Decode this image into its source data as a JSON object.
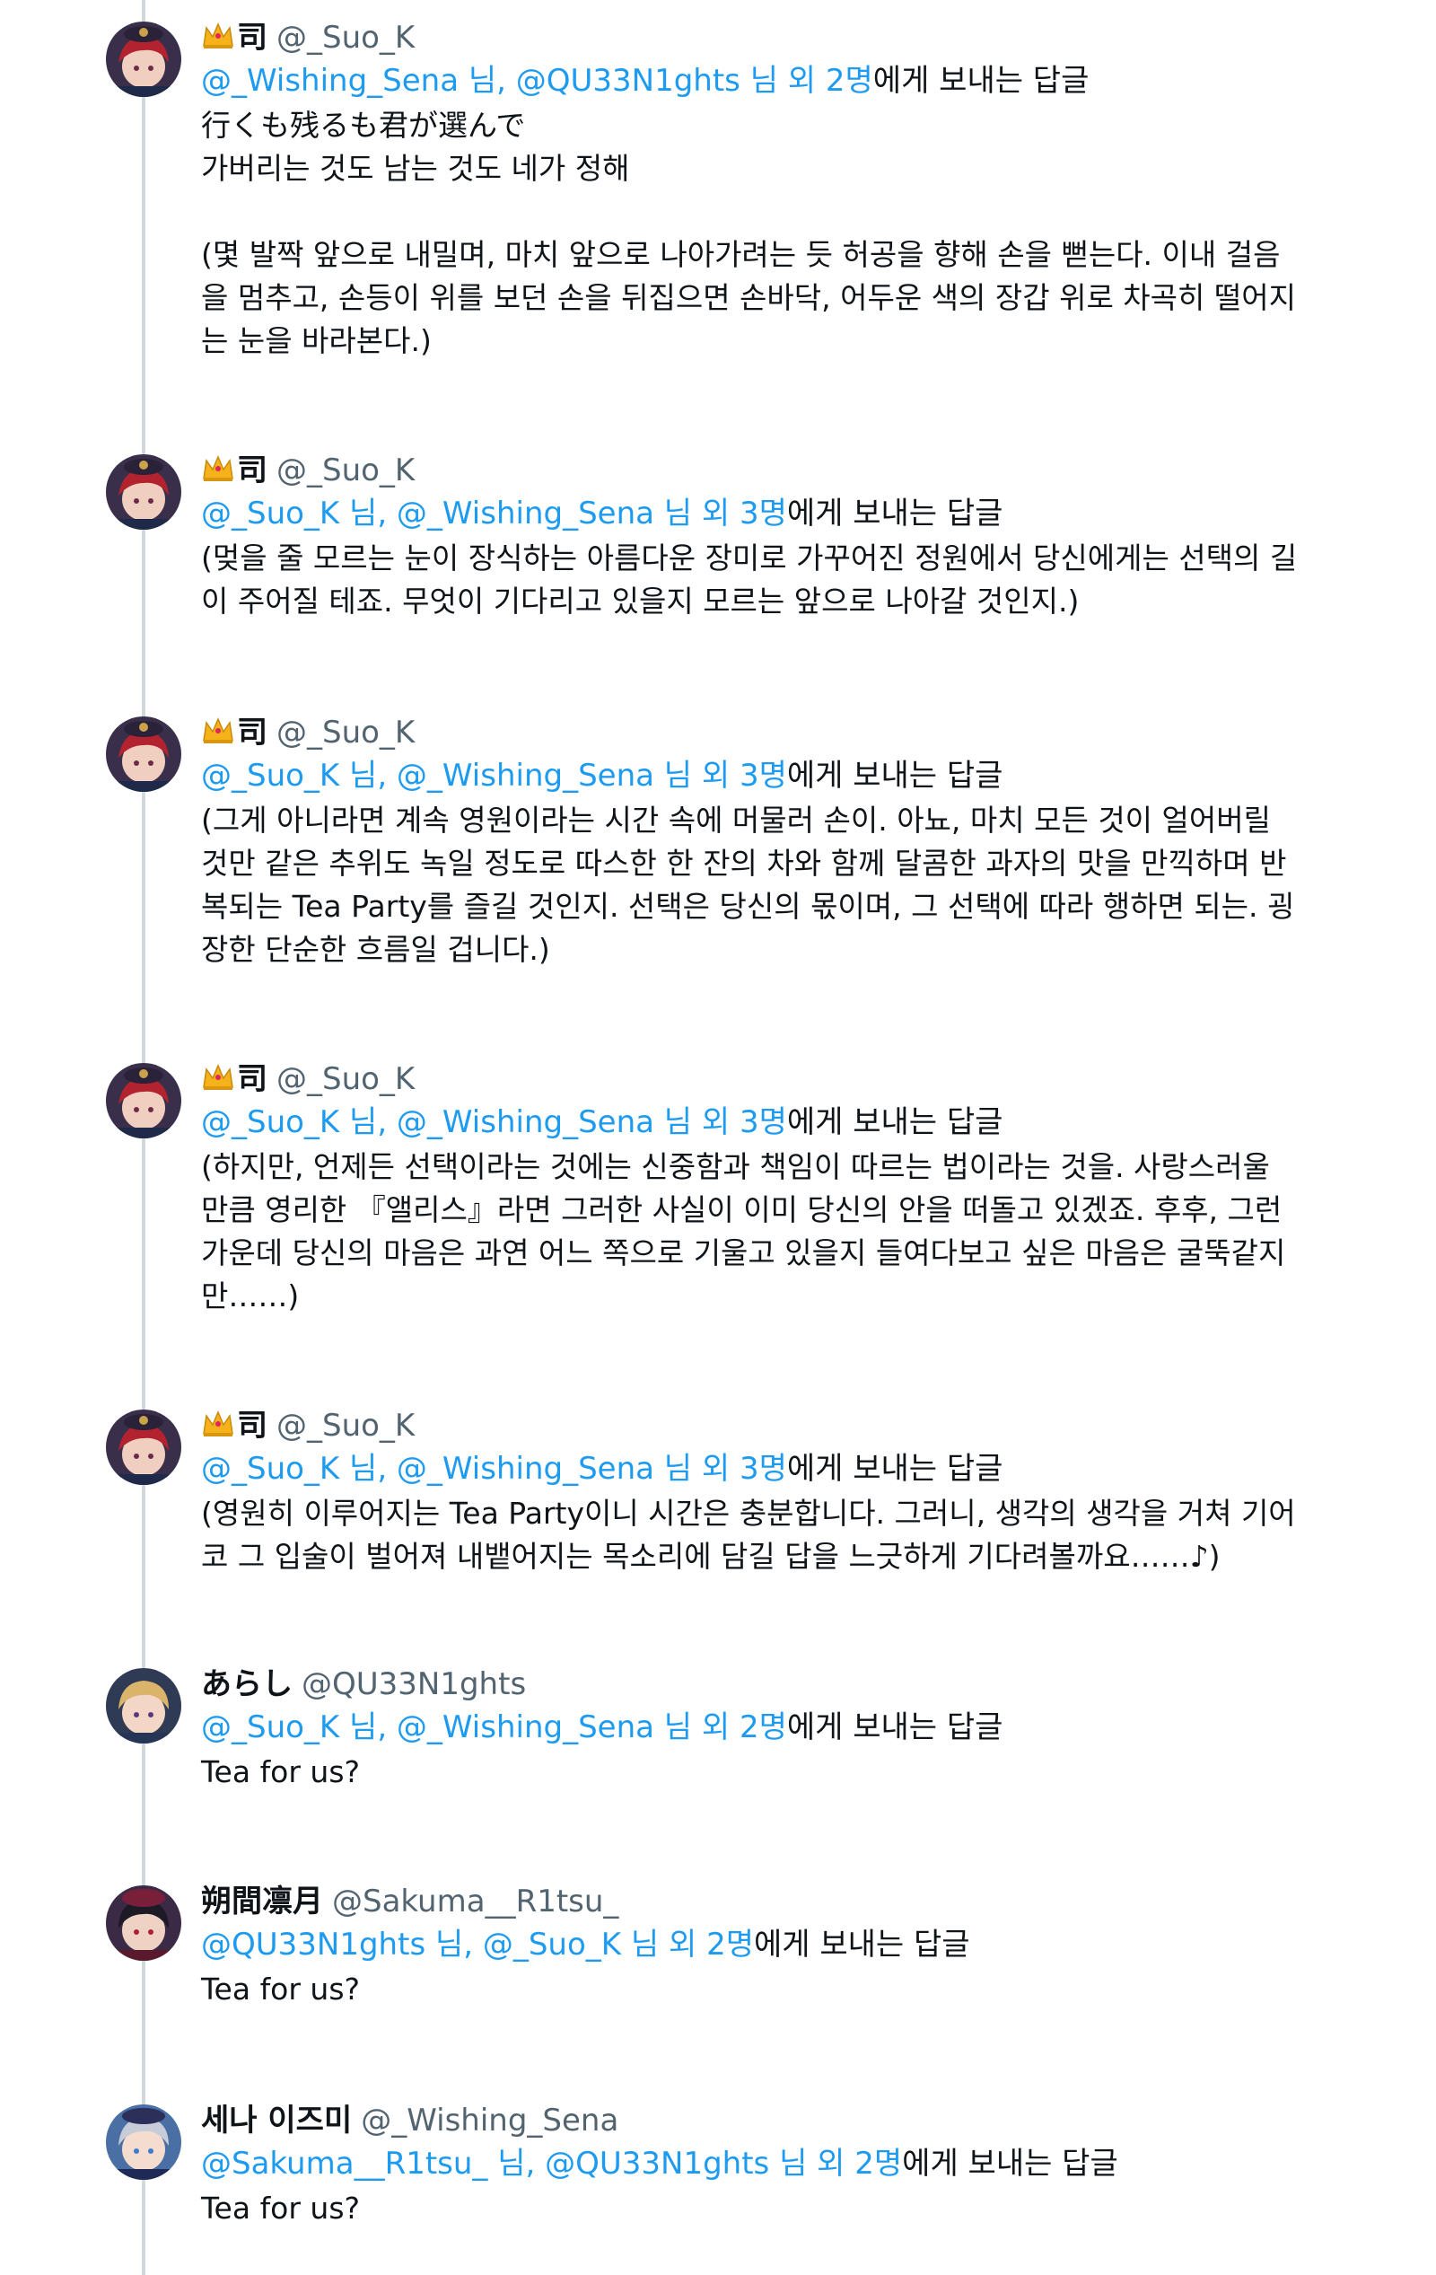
{
  "reply_suffix": "에게 보내는 답글",
  "tweets": [
    {
      "display_name": "司",
      "crown": true,
      "handle": "@_Suo_K",
      "avatar": "suo-avatar",
      "reply_to": "@_Wishing_Sena 님, @QU33N1ghts 님 외 2명",
      "text": "行くも残るも君が選んで\n가버리는 것도 남는 것도 네가 정해\n\n(몇 발짝 앞으로 내밀며, 마치 앞으로 나아가려는 듯 허공을 향해 손을 뻗는다. 이내 걸음을 멈추고, 손등이 위를 보던 손을 뒤집으면 손바닥, 어두운 색의 장갑 위로 차곡히 떨어지는 눈을 바라본다.)"
    },
    {
      "display_name": "司",
      "crown": true,
      "handle": "@_Suo_K",
      "avatar": "suo-avatar",
      "reply_to": "@_Suo_K 님, @_Wishing_Sena 님 외 3명",
      "text": "(멎을 줄 모르는 눈이 장식하는 아름다운 장미로 가꾸어진 정원에서 당신에게는 선택의 길이 주어질 테죠. 무엇이 기다리고 있을지 모르는 앞으로 나아갈 것인지.)"
    },
    {
      "display_name": "司",
      "crown": true,
      "handle": "@_Suo_K",
      "avatar": "suo-avatar",
      "reply_to": "@_Suo_K 님, @_Wishing_Sena 님 외 3명",
      "text": "(그게 아니라면 계속 영원이라는 시간 속에 머물러 손이. 아뇨, 마치 모든 것이 얼어버릴 것만 같은 추위도 녹일 정도로 따스한 한 잔의 차와 함께 달콤한 과자의 맛을 만끽하며 반복되는 Tea Party를 즐길 것인지. 선택은 당신의 몫이며, 그 선택에 따라 행하면 되는. 굉장한 단순한 흐름일 겁니다.)"
    },
    {
      "display_name": "司",
      "crown": true,
      "handle": "@_Suo_K",
      "avatar": "suo-avatar",
      "reply_to": "@_Suo_K 님, @_Wishing_Sena 님 외 3명",
      "text": "(하지만, 언제든 선택이라는 것에는 신중함과 책임이 따르는 법이라는 것을. 사랑스러울 만큼 영리한 『앨리스』라면 그러한 사실이 이미 당신의 안을 떠돌고 있겠죠. 후후, 그런 가운데 당신의 마음은 과연 어느 쪽으로 기울고 있을지 들여다보고 싶은 마음은 굴뚝같지만……)"
    },
    {
      "display_name": "司",
      "crown": true,
      "handle": "@_Suo_K",
      "avatar": "suo-avatar",
      "reply_to": "@_Suo_K 님, @_Wishing_Sena 님 외 3명",
      "text": "(영원히 이루어지는 Tea Party이니 시간은 충분합니다. 그러니, 생각의 생각을 거쳐 기어코 그 입술이 벌어져 내뱉어지는 목소리에 담길 답을 느긋하게 기다려볼까요……♪)"
    },
    {
      "display_name": "あらし",
      "crown": false,
      "handle": "@QU33N1ghts",
      "avatar": "arashi-avatar",
      "reply_to": "@_Suo_K 님, @_Wishing_Sena 님 외 2명",
      "text": "Tea for us?"
    },
    {
      "display_name": "朔間凛月",
      "crown": false,
      "handle": "@Sakuma__R1tsu_",
      "avatar": "ritsu-avatar",
      "reply_to": "@QU33N1ghts 님, @_Suo_K 님 외 2명",
      "text": "Tea for us?"
    },
    {
      "display_name": "세나 이즈미",
      "crown": false,
      "handle": "@_Wishing_Sena",
      "avatar": "sena-avatar",
      "reply_to": "@Sakuma__R1tsu_ 님, @QU33N1ghts 님 외 2명",
      "text": "Tea for us?"
    }
  ]
}
